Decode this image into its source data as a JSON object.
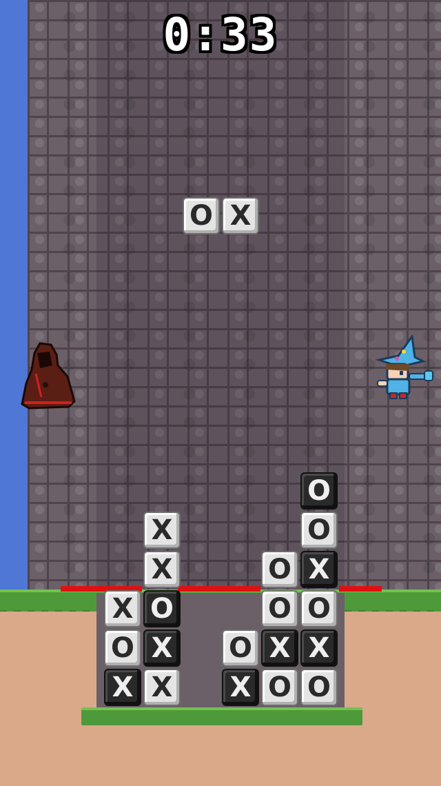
{
  "timer": {
    "text": "0:33"
  },
  "colors": {
    "sky": "#4f77d6",
    "wall": "#6b6068",
    "grass": "#4e9a3a",
    "ground": "#d9a98a",
    "limit_line": "#e01010"
  },
  "falling_piece": {
    "tiles": [
      {
        "symbol": "O",
        "shade": "light"
      },
      {
        "symbol": "X",
        "shade": "light"
      }
    ]
  },
  "board": {
    "columns": [
      {
        "tiles_bottom_to_top": [
          {
            "symbol": "X",
            "shade": "dark"
          },
          {
            "symbol": "O",
            "shade": "light"
          },
          {
            "symbol": "X",
            "shade": "light"
          }
        ]
      },
      {
        "tiles_bottom_to_top": [
          {
            "symbol": "X",
            "shade": "light"
          },
          {
            "symbol": "X",
            "shade": "dark"
          },
          {
            "symbol": "O",
            "shade": "dark"
          },
          {
            "symbol": "X",
            "shade": "light"
          },
          {
            "symbol": "X",
            "shade": "light"
          }
        ]
      },
      {
        "tiles_bottom_to_top": []
      },
      {
        "tiles_bottom_to_top": [
          {
            "symbol": "X",
            "shade": "dark"
          },
          {
            "symbol": "O",
            "shade": "light"
          }
        ]
      },
      {
        "tiles_bottom_to_top": [
          {
            "symbol": "O",
            "shade": "light"
          },
          {
            "symbol": "X",
            "shade": "dark"
          },
          {
            "symbol": "O",
            "shade": "light"
          },
          {
            "symbol": "O",
            "shade": "light"
          }
        ]
      },
      {
        "tiles_bottom_to_top": [
          {
            "symbol": "O",
            "shade": "light"
          },
          {
            "symbol": "X",
            "shade": "dark"
          },
          {
            "symbol": "O",
            "shade": "light"
          },
          {
            "symbol": "X",
            "shade": "dark"
          },
          {
            "symbol": "O",
            "shade": "light"
          },
          {
            "symbol": "O",
            "shade": "dark"
          }
        ]
      }
    ]
  },
  "characters": [
    {
      "name": "hooded-figure"
    },
    {
      "name": "wizard"
    }
  ]
}
